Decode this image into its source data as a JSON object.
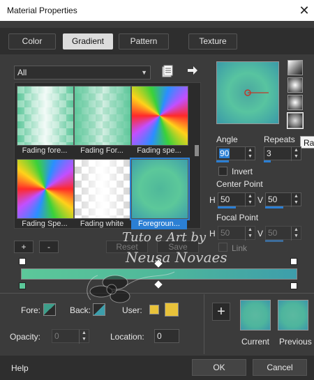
{
  "window": {
    "title": "Material Properties",
    "close_glyph": "✕"
  },
  "tabs": [
    {
      "label": "Color"
    },
    {
      "label": "Gradient"
    },
    {
      "label": "Pattern"
    },
    {
      "label": "Texture"
    }
  ],
  "category": {
    "value": "All"
  },
  "gallery": {
    "items": [
      {
        "label": "Fading fore..."
      },
      {
        "label": "Fading For..."
      },
      {
        "label": "Fading spe..."
      },
      {
        "label": "Fading Spe..."
      },
      {
        "label": "Fading white"
      },
      {
        "label": "Foregroun..."
      }
    ]
  },
  "editor_buttons": {
    "add": "+",
    "remove": "-",
    "reset": "Reset",
    "save": "Save"
  },
  "settings": {
    "angle_label": "Angle",
    "angle_value": "90",
    "repeats_label": "Repeats",
    "repeats_value": "3",
    "invert_label": "Invert",
    "center_point_label": "Center Point",
    "center_h_label": "H",
    "center_h_value": "50",
    "center_v_label": "V",
    "center_v_value": "50",
    "focal_point_label": "Focal Point",
    "focal_h_label": "H",
    "focal_h_value": "50",
    "focal_v_label": "V",
    "focal_v_value": "50",
    "link_label": "Link"
  },
  "tooltip": {
    "text": "Rad"
  },
  "colors": {
    "fore_label": "Fore:",
    "back_label": "Back:",
    "user_label": "User:",
    "opacity_label": "Opacity:",
    "opacity_value": "0",
    "location_label": "Location:",
    "location_value": "0",
    "user_color": "#e8c23a",
    "accent": "#2b7fd4"
  },
  "samples": {
    "add_glyph": "+",
    "current_label": "Current",
    "previous_label": "Previous"
  },
  "footer": {
    "help": "Help",
    "ok": "OK",
    "cancel": "Cancel"
  },
  "watermark": {
    "line1": "Tuto e Art by",
    "line2": "Neusa Novaes"
  }
}
